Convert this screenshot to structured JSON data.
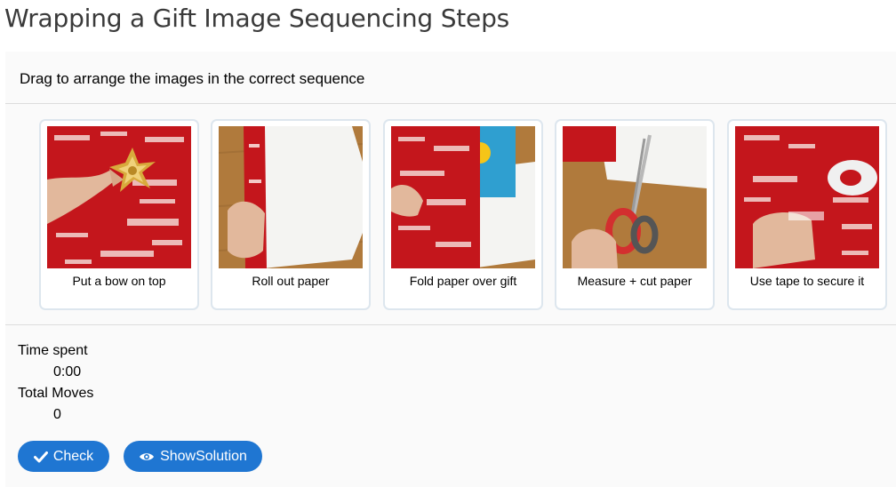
{
  "page": {
    "title": "Wrapping a Gift Image Sequencing Steps"
  },
  "task": {
    "instruction": "Drag to arrange the images in the correct sequence"
  },
  "cards": [
    {
      "label": "Put a bow on top",
      "icon": "bow-photo"
    },
    {
      "label": "Roll out paper",
      "icon": "roll-paper-photo"
    },
    {
      "label": "Fold paper over gift",
      "icon": "fold-paper-photo"
    },
    {
      "label": "Measure + cut paper",
      "icon": "scissors-photo"
    },
    {
      "label": "Use tape to secure it",
      "icon": "tape-photo"
    }
  ],
  "stats": {
    "time_label": "Time spent",
    "time_value": "0:00",
    "moves_label": "Total Moves",
    "moves_value": "0"
  },
  "buttons": {
    "check": "Check",
    "solution": "ShowSolution"
  },
  "colors": {
    "accent": "#1f76d2",
    "wrap_red": "#c4161c",
    "wood": "#b07a3c"
  }
}
